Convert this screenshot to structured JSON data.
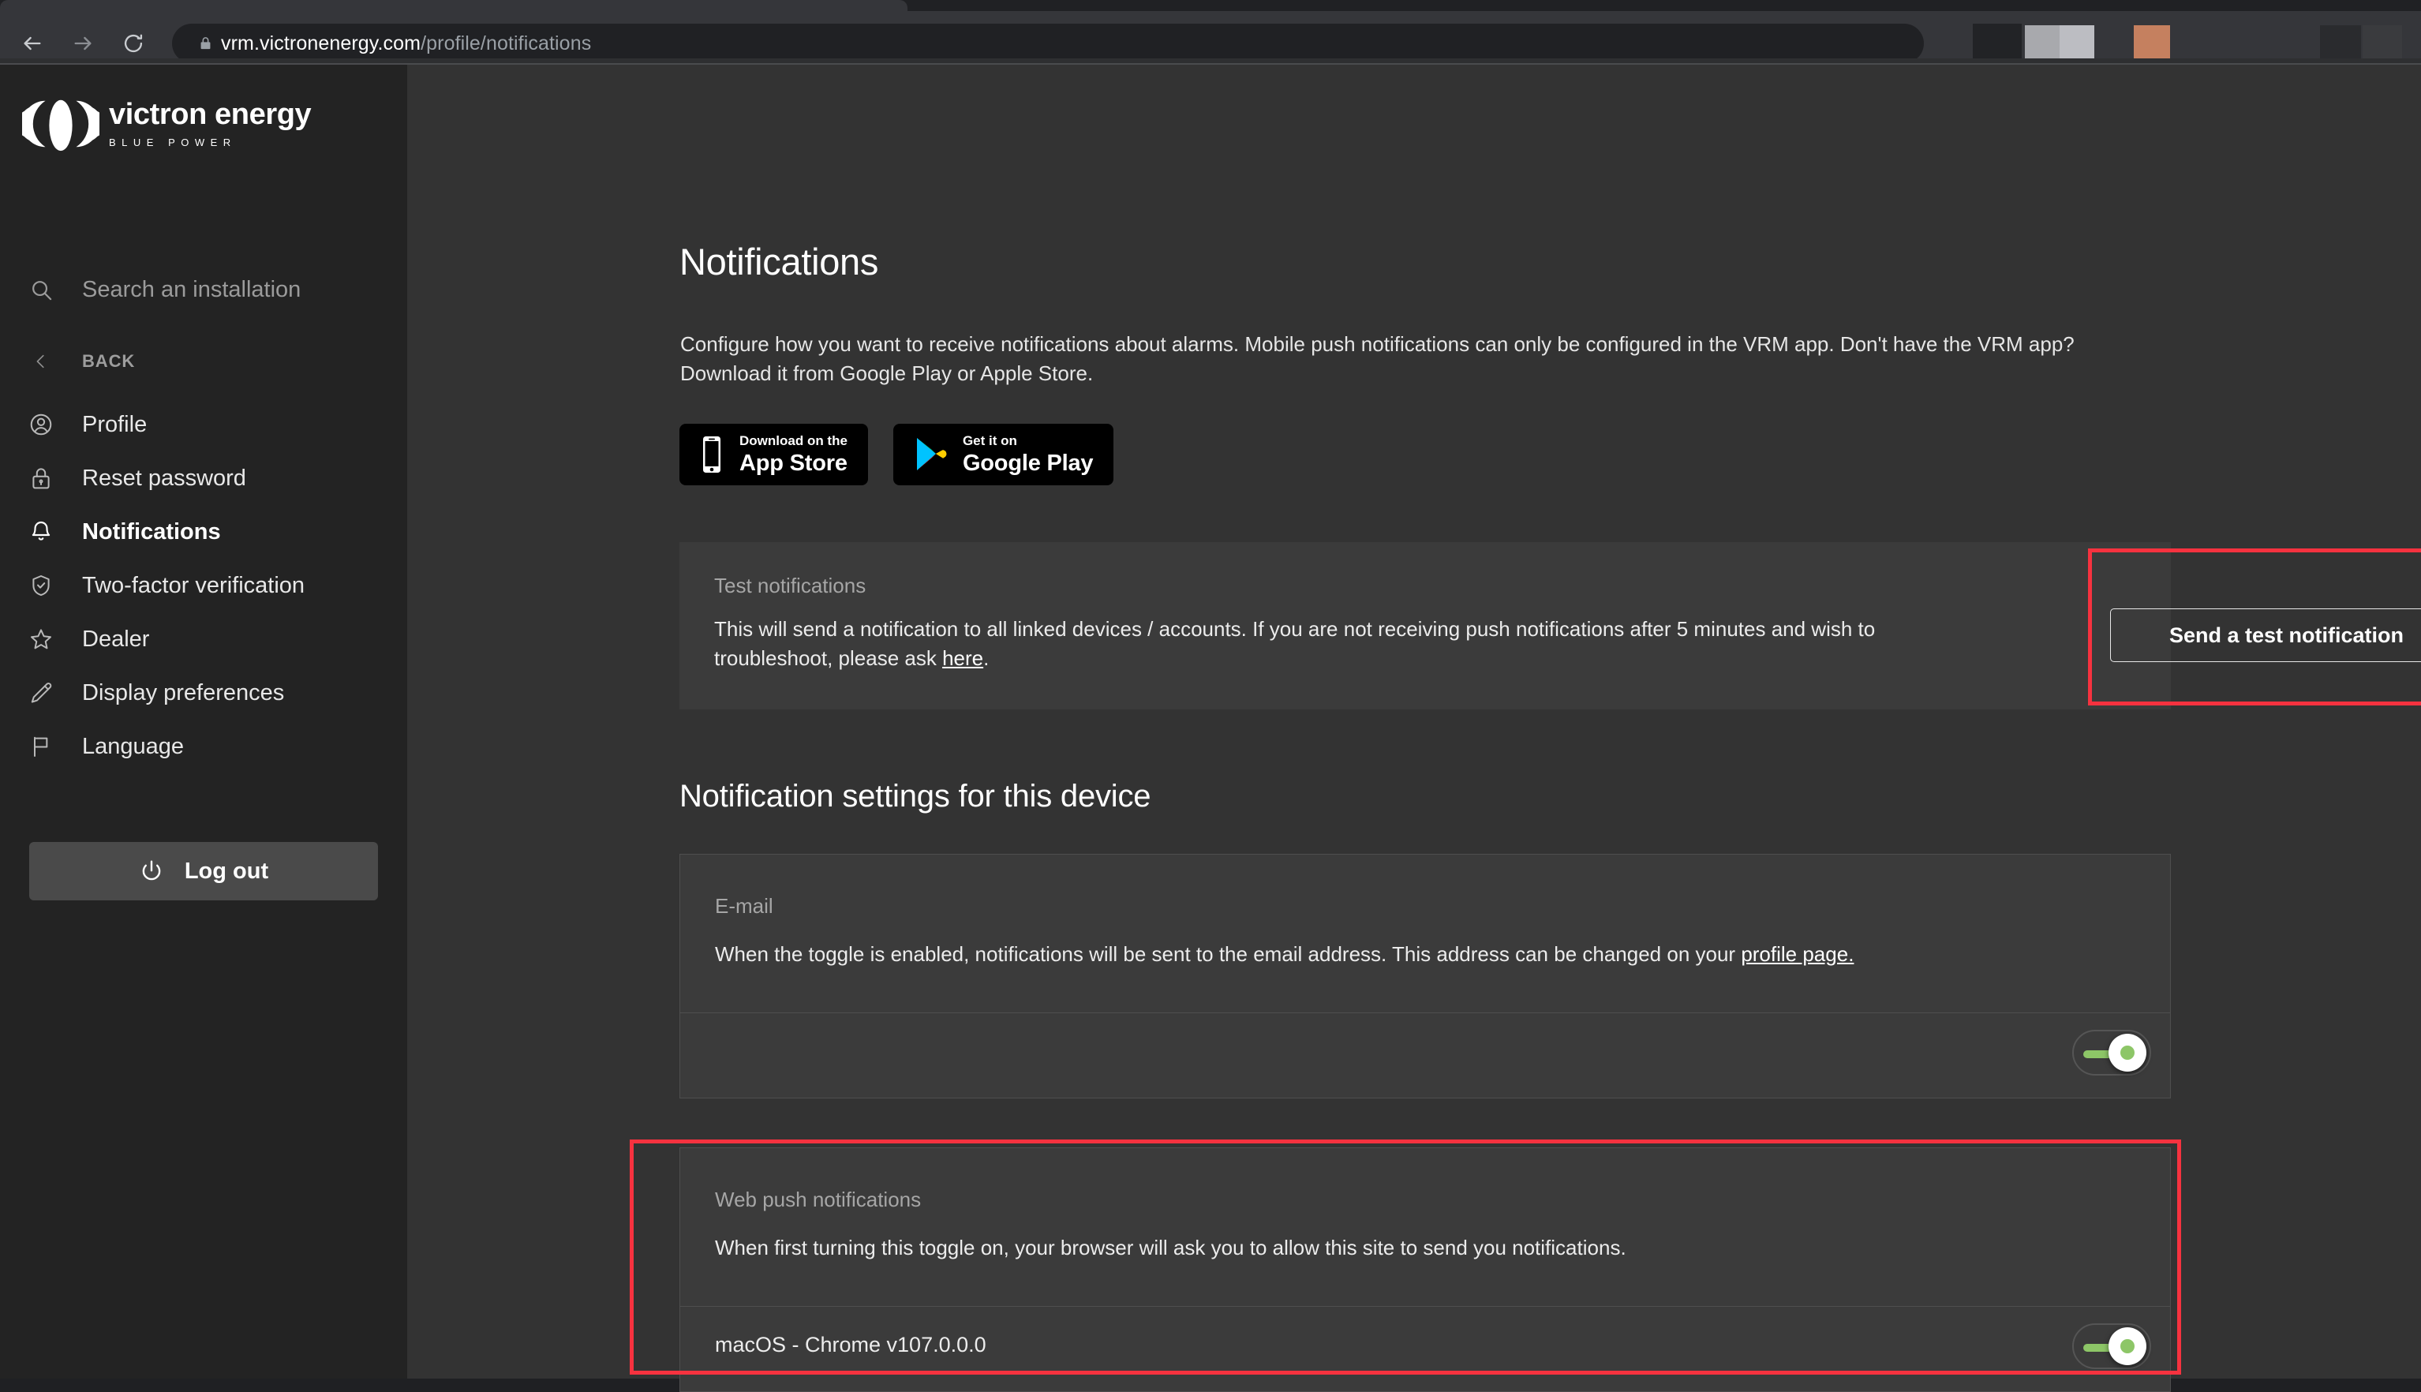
{
  "browser": {
    "back_icon": "arrow-left-icon",
    "forward_icon": "arrow-right-icon",
    "reload_icon": "reload-icon",
    "lock_icon": "lock-icon",
    "url_host": "vrm.victronenergy.com",
    "url_path": "/profile/notifications"
  },
  "sidebar": {
    "logo": {
      "name": "victron energy",
      "tagline": "BLUE POWER"
    },
    "search": {
      "placeholder": "Search an installation",
      "icon": "search-icon"
    },
    "items": [
      {
        "label": "BACK",
        "icon": "chevron-left-icon",
        "active": false
      },
      {
        "label": "Profile",
        "icon": "user-circle-icon",
        "active": false
      },
      {
        "label": "Reset password",
        "icon": "lock-icon",
        "active": false
      },
      {
        "label": "Notifications",
        "icon": "bell-icon",
        "active": true
      },
      {
        "label": "Two-factor verification",
        "icon": "shield-check-icon",
        "active": false
      },
      {
        "label": "Dealer",
        "icon": "star-icon",
        "active": false
      },
      {
        "label": "Display preferences",
        "icon": "pencil-icon",
        "active": false
      },
      {
        "label": "Language",
        "icon": "flag-icon",
        "active": false
      }
    ],
    "logout": {
      "label": "Log out",
      "icon": "power-icon"
    }
  },
  "main": {
    "title": "Notifications",
    "description": "Configure how you want to receive notifications about alarms. Mobile push notifications can only be configured in the VRM app. Don't have the VRM app? Download it from Google Play or Apple Store.",
    "store_badges": [
      {
        "icon": "apple-iphone-icon",
        "line1": "Download on the",
        "line2": "App Store"
      },
      {
        "icon": "google-play-icon",
        "line1": "Get it on",
        "line2": "Google Play"
      }
    ],
    "test_card": {
      "title": "Test notifications",
      "body_before_link": "This will send a notification to all linked devices / accounts. If you are not receiving push notifications after 5 minutes and wish to troubleshoot, please ask ",
      "link_text": "here",
      "body_after_link": ".",
      "button_label": "Send a test notification"
    },
    "section_title": "Notification settings for this device",
    "email_card": {
      "title": "E-mail",
      "body_before_link": "When the toggle is enabled, notifications will be sent to the email address. This address can be changed on your ",
      "link_text": "profile page.",
      "body_after_link": "",
      "toggle_state": "on"
    },
    "webpush_card": {
      "title": "Web push notifications",
      "body": "When first turning this toggle on, your browser will ask you to allow this site to send you notifications.",
      "device_label": "macOS - Chrome v107.0.0.0",
      "toggle_state": "on"
    }
  },
  "annotations": {
    "color": "#f6323f",
    "boxes": [
      "send-test-notification-button",
      "web-push-notifications-card"
    ]
  },
  "colors": {
    "sidebar_bg": "#232323",
    "page_bg": "#333333",
    "card_bg": "#3b3b3b",
    "toggle_green": "#8dc667",
    "annotation_red": "#f6323f"
  }
}
